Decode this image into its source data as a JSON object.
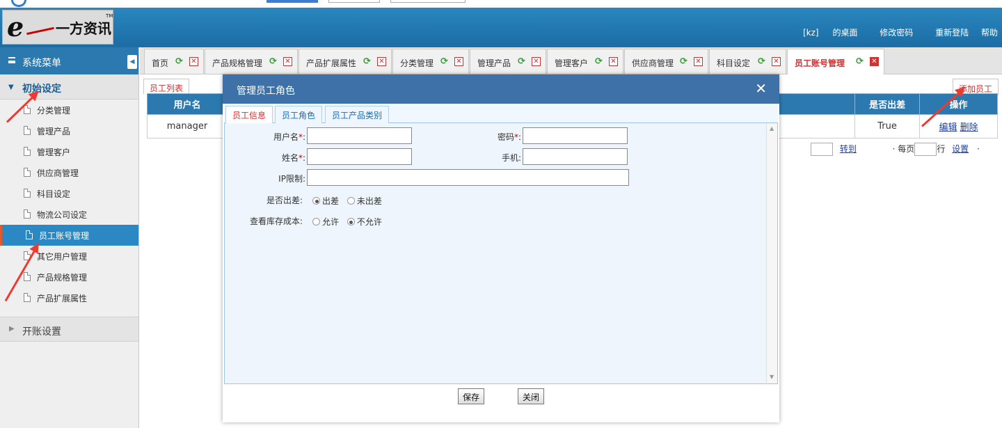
{
  "header": {
    "logo_letter": "e",
    "logo_text": "一方资讯",
    "logo_tm": "TM",
    "nav": [
      "[kz]",
      "的桌面",
      "修改密码",
      "重新登陆",
      "帮助"
    ]
  },
  "sidebar": {
    "title": "系统菜单",
    "group1": "初始设定",
    "items": [
      "分类管理",
      "管理产品",
      "管理客户",
      "供应商管理",
      "科目设定",
      "物流公司设定",
      "员工账号管理",
      "其它用户管理",
      "产品规格管理",
      "产品扩展属性"
    ],
    "active_index": 6,
    "group2": "开账设置"
  },
  "tabs": [
    "首页",
    "产品规格管理",
    "产品扩展属性",
    "分类管理",
    "管理产品",
    "管理客户",
    "供应商管理",
    "科目设定",
    "员工账号管理"
  ],
  "content": {
    "subtab": "员工列表",
    "add_link": "添加员工",
    "columns": [
      "用户名",
      "是否出差",
      "操作"
    ],
    "row": {
      "username": "manager",
      "travel": "True",
      "edit": "编辑",
      "delete": "删除"
    },
    "pager": {
      "goto": "转到",
      "per_page_prefix": "· 每页",
      "per_page_suffix": "行",
      "settings": "设置",
      "dot": "·"
    }
  },
  "dialog": {
    "title": "管理员工角色",
    "close_glyph": "✕",
    "tabs": [
      "员工信息",
      "员工角色",
      "员工产品类别"
    ],
    "fields": {
      "username_label": "用户名",
      "password_label": "密码",
      "name_label": "姓名",
      "mobile_label": "手机",
      "ip_label": "IP限制:",
      "required_mark": "*",
      "colon": ":",
      "travel_label": "是否出差:",
      "travel_options": [
        "出差",
        "未出差"
      ],
      "travel_selected": 0,
      "cost_label": "查看库存成本:",
      "cost_options": [
        "允许",
        "不允许"
      ],
      "cost_selected": 1
    },
    "save_button": "保存",
    "close_button": "关闭"
  },
  "colors": {
    "accent": "#2b79ae",
    "dialog_header": "#3e71a8",
    "active_red": "#cc3333",
    "arrow": "#ee3b30"
  }
}
